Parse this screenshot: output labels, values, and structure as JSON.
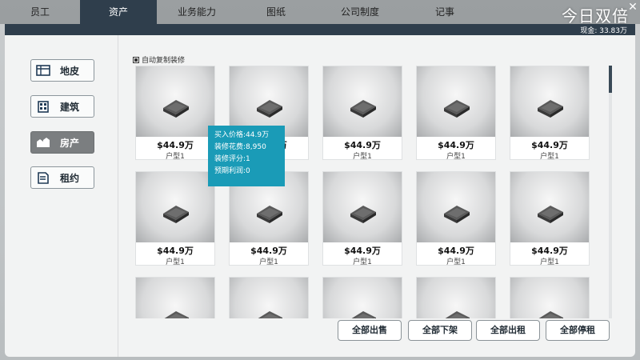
{
  "tabs": [
    "员工",
    "资产",
    "业务能力",
    "图纸",
    "公司制度",
    "记事"
  ],
  "active_tab": 1,
  "brand": "今日双倍",
  "cash_text": "现金: 33.83万",
  "sidebar": {
    "items": [
      {
        "label": "地皮",
        "icon": "map-icon"
      },
      {
        "label": "建筑",
        "icon": "building-icon"
      },
      {
        "label": "房产",
        "icon": "property-icon"
      },
      {
        "label": "租约",
        "icon": "contract-icon"
      }
    ],
    "active": 2
  },
  "auto_copy": {
    "label": "自动复制装修",
    "checked": true
  },
  "cards": [
    {
      "price": "$44.9万",
      "type": "户型1"
    },
    {
      "price": "$44.9万",
      "type": "户型1"
    },
    {
      "price": "$44.9万",
      "type": "户型1"
    },
    {
      "price": "$44.9万",
      "type": "户型1"
    },
    {
      "price": "$44.9万",
      "type": "户型1"
    },
    {
      "price": "$44.9万",
      "type": "户型1"
    },
    {
      "price": "$44.9万",
      "type": "户型1"
    },
    {
      "price": "$44.9万",
      "type": "户型1"
    },
    {
      "price": "$44.9万",
      "type": "户型1"
    },
    {
      "price": "$44.9万",
      "type": "户型1"
    },
    {
      "price": "",
      "type": ""
    },
    {
      "price": "",
      "type": ""
    },
    {
      "price": "",
      "type": ""
    },
    {
      "price": "",
      "type": ""
    },
    {
      "price": "",
      "type": ""
    }
  ],
  "tooltip": {
    "buy_price": "买入价格:44.9万",
    "decor_cost": "装修花费:8,950",
    "decor_score": "装修评分:1",
    "expected_profit": "预期利润:0"
  },
  "actions": [
    "全部出售",
    "全部下架",
    "全部出租",
    "全部停租"
  ],
  "colors": {
    "active_tab": "#2f3e4c",
    "tooltip": "#1a9bb7",
    "active_side": "#7b7e80"
  }
}
